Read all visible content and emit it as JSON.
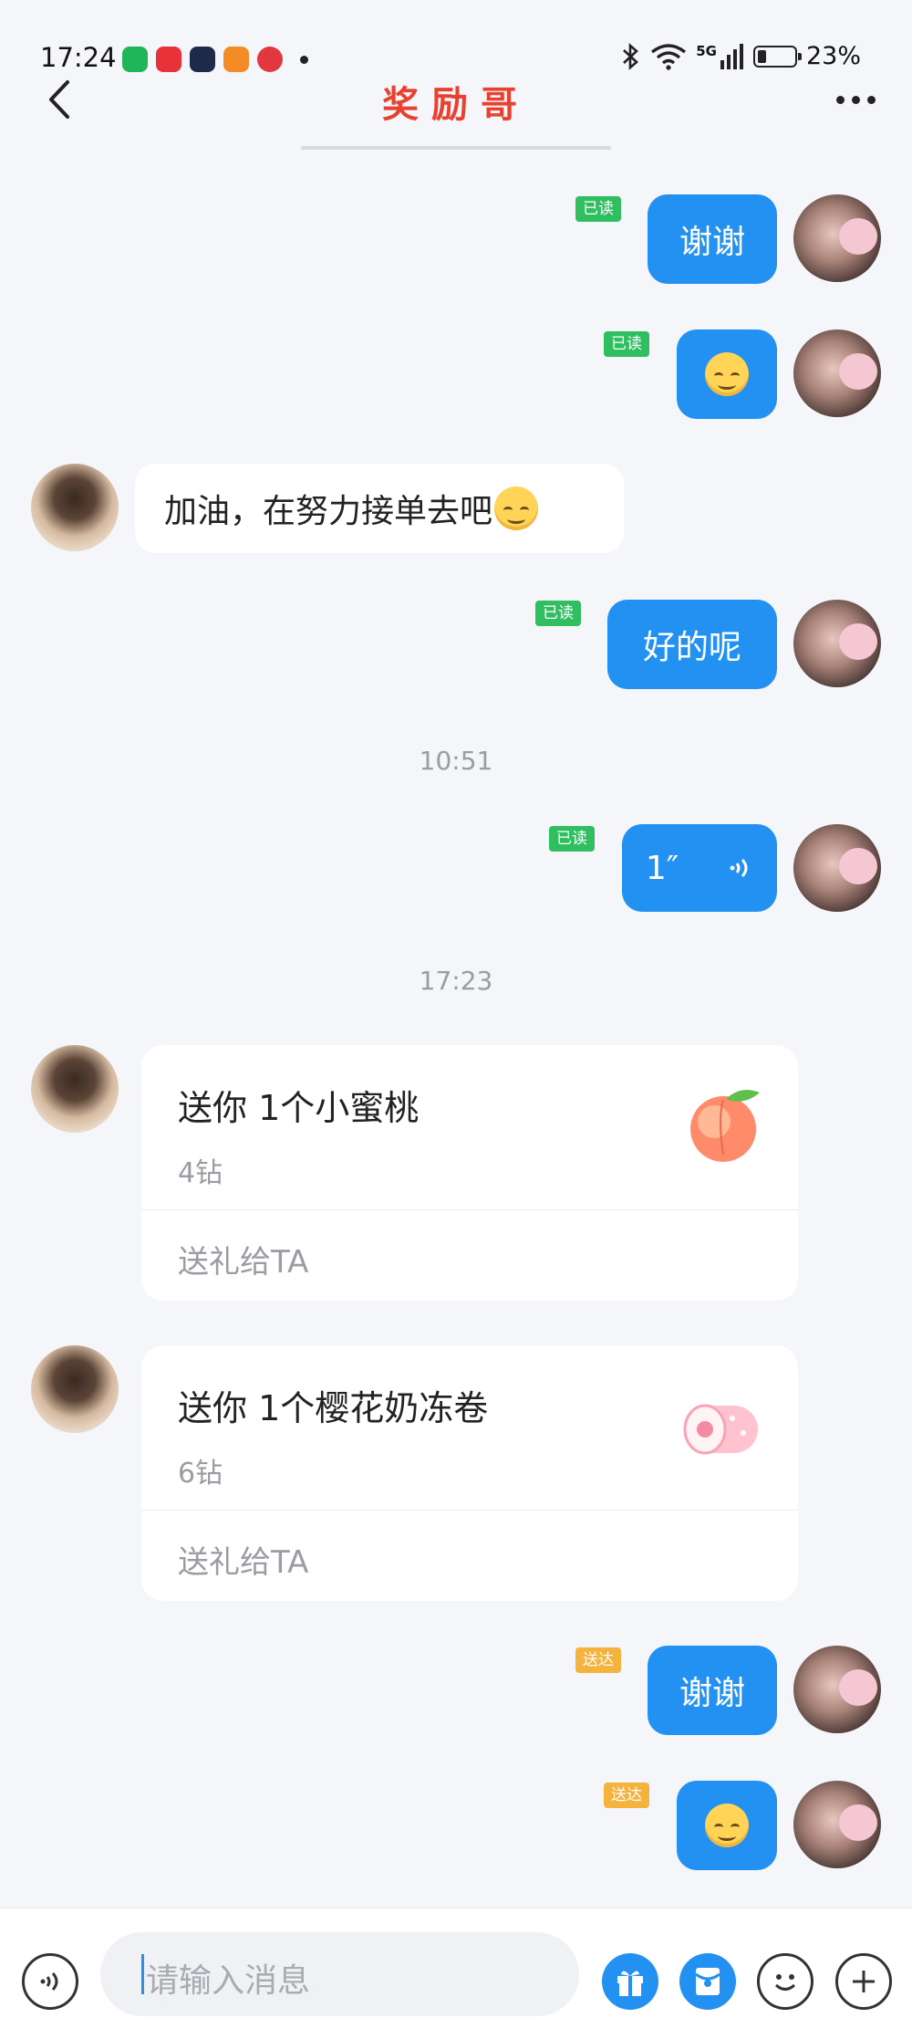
{
  "status_bar": {
    "time": "17:24",
    "battery_percent": "23%",
    "battery_level": 0.23,
    "network": "5G",
    "app_icons": [
      {
        "name": "wechat-icon",
        "color": "#1fb65a"
      },
      {
        "name": "red-app-icon",
        "color": "#e7323a"
      },
      {
        "name": "dark-app-icon",
        "color": "#1d2a4a"
      },
      {
        "name": "orange-app-icon",
        "color": "#f58b25"
      },
      {
        "name": "netease-music-icon",
        "color": "#e2373e"
      }
    ]
  },
  "header": {
    "title": "奖励哥"
  },
  "messages": {
    "m1": {
      "text": "谢谢",
      "tag": "已读"
    },
    "m2": {
      "tag": "已读",
      "emoji": "smiling-face-icon"
    },
    "m3": {
      "text": "加油，在努力接单去吧"
    },
    "m4": {
      "text": "好的呢",
      "tag": "已读"
    },
    "ts1": "10:51",
    "m5": {
      "text": "1″",
      "tag": "已读"
    },
    "ts2": "17:23",
    "gift1": {
      "title": "送你 1个小蜜桃",
      "price": "4钻",
      "action": "送礼给TA"
    },
    "gift2": {
      "title": "送你 1个樱花奶冻卷",
      "price": "6钻",
      "action": "送礼给TA"
    },
    "m6": {
      "text": "谢谢",
      "tag": "送达"
    },
    "m7": {
      "tag": "送达"
    }
  },
  "input": {
    "placeholder": "请输入消息"
  },
  "colors": {
    "accent": "#2391f2",
    "title": "#e8412f",
    "read_tag": "#2fbf61",
    "sent_tag": "#f4b33d"
  }
}
